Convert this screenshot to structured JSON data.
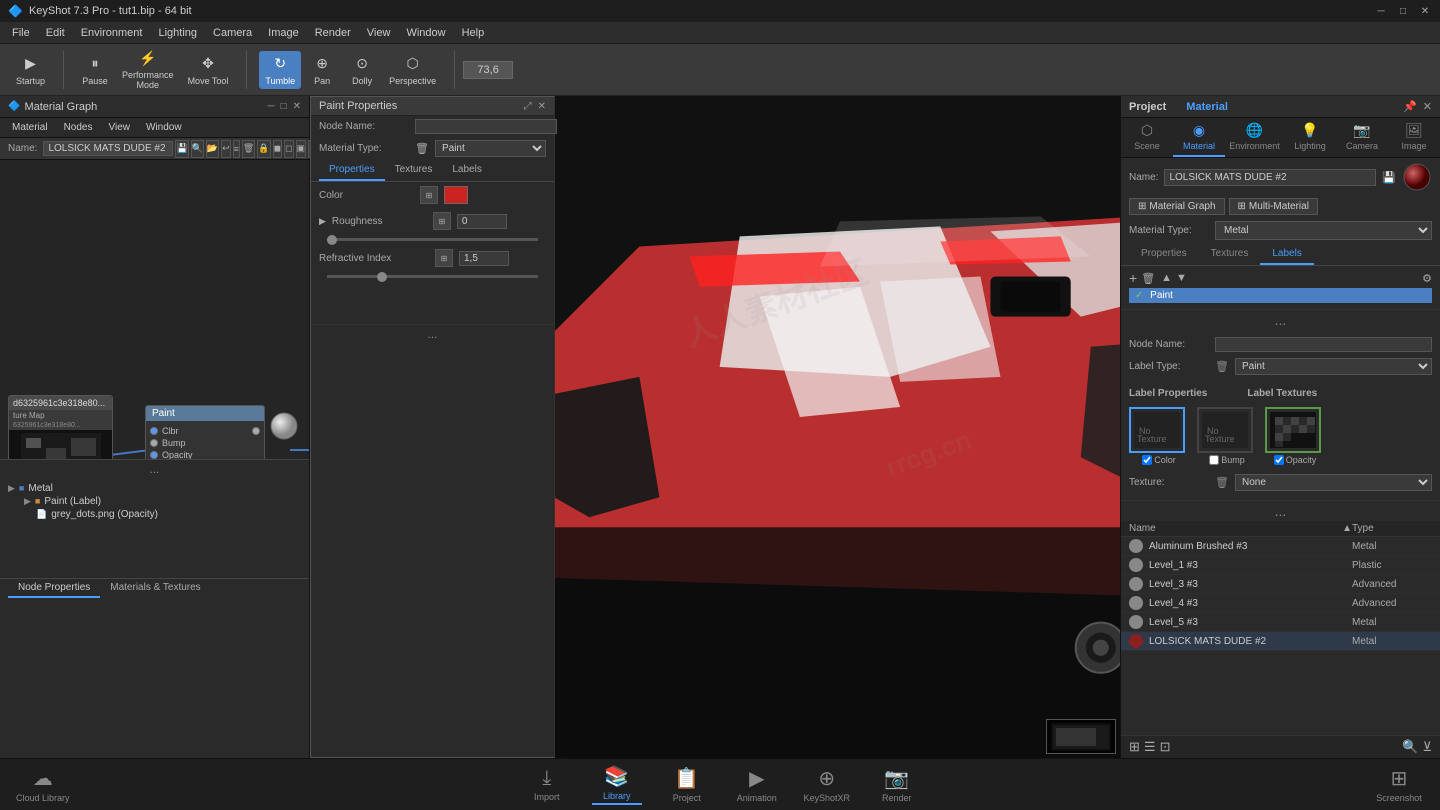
{
  "app": {
    "title": "KeyShot 7.3 Pro - tut1.bip - 64 bit",
    "watermark": "rrcg.cn"
  },
  "menu": {
    "items": [
      "File",
      "Edit",
      "Environment",
      "Lighting",
      "Camera",
      "Image",
      "Render",
      "View",
      "Window",
      "Help"
    ]
  },
  "toolbar": {
    "startup_label": "Startup",
    "pause_label": "Pause",
    "performance_label": "Performance\nMode",
    "move_tool_label": "Move\nTool",
    "tumble_label": "Tumble",
    "pan_label": "Pan",
    "dolly_label": "Dolly",
    "perspective_label": "Perspective",
    "fps_value": "73,6"
  },
  "material_graph": {
    "title": "Material Graph",
    "menu_items": [
      "Material",
      "Nodes",
      "View",
      "Window"
    ],
    "name_label": "Name:",
    "name_value": "LOLSICK MATS DUDE #2",
    "node_texture_title": "d6325961c3e318e80...",
    "node_texture_sub": "ture Map",
    "node_texture_sub2": "6325961c3e318e80...",
    "node_paint_title": "Paint",
    "node_paint_ports": [
      "Clbr",
      "Bump",
      "Opacity"
    ],
    "canvas_dots": "..."
  },
  "paint_properties": {
    "title": "Paint Properties",
    "node_name_label": "Node Name:",
    "node_name_value": "",
    "material_type_label": "Material Type:",
    "material_type_value": "Paint",
    "tabs": [
      "Properties",
      "Textures",
      "Labels"
    ],
    "active_tab": "Properties",
    "color_label": "Color",
    "roughness_label": "Roughness",
    "roughness_value": "0",
    "refractive_index_label": "Refractive Index",
    "refractive_index_value": "1.5",
    "bottom_dots": "...",
    "tree_items": [
      {
        "label": "Metal",
        "type": "folder"
      },
      {
        "label": "Paint (Label)",
        "type": "item"
      },
      {
        "label": "grey_dots.png (Opacity)",
        "type": "file"
      }
    ],
    "footer_tabs": [
      "Node Properties",
      "Materials & Textures"
    ]
  },
  "right_panel": {
    "project_title": "Project",
    "material_title": "Material",
    "tabs": [
      "Scene",
      "Material",
      "Environment",
      "Lighting",
      "Camera",
      "Image"
    ],
    "active_tab": "Material",
    "name_label": "Name:",
    "name_value": "LOLSICK MATS DUDE #2",
    "mat_graph_btn": "Material Graph",
    "multi_mat_btn": "Multi-Material",
    "mat_type_label": "Material Type:",
    "mat_type_value": "Metal",
    "inner_tabs": [
      "Properties",
      "Textures",
      "Labels"
    ],
    "active_inner_tab": "Labels",
    "node_name_label": "Node Name:",
    "node_name_value": "",
    "label_type_label": "Label Type:",
    "label_type_value": "Paint",
    "label_items": [
      "Paint"
    ],
    "label_props_title": "Label Properties",
    "label_textures_title": "Label Textures",
    "label_thumbs": [
      "Color",
      "Bump",
      "Opacity"
    ],
    "texture_label": "Texture:",
    "texture_value": "None",
    "materials_list": {
      "col_name": "Name",
      "col_type": "Type",
      "sort_indicator": "▲",
      "items": [
        {
          "name": "Aluminum Brushed #3",
          "type": "Metal",
          "color": "#888"
        },
        {
          "name": "Level_1 #3",
          "type": "Plastic",
          "color": "#888"
        },
        {
          "name": "Level_3 #3",
          "type": "Advanced",
          "color": "#888"
        },
        {
          "name": "Level_4 #3",
          "type": "Advanced",
          "color": "#888"
        },
        {
          "name": "Level_5 #3",
          "type": "Metal",
          "color": "#888"
        },
        {
          "name": "LOLSICK MATS DUDE #2",
          "type": "Metal",
          "color": "#8b2020"
        }
      ]
    },
    "bottom_icons": [
      "⊞",
      "☰",
      "⊡",
      "⌕",
      "⌕"
    ]
  },
  "bottom_bar": {
    "cloud_library_label": "Cloud Library",
    "import_label": "Import",
    "library_label": "Library",
    "project_label": "Project",
    "animation_label": "Animation",
    "keyshot_xr_label": "KeyShotXR",
    "render_label": "Render",
    "screenshot_label": "Screenshot"
  }
}
